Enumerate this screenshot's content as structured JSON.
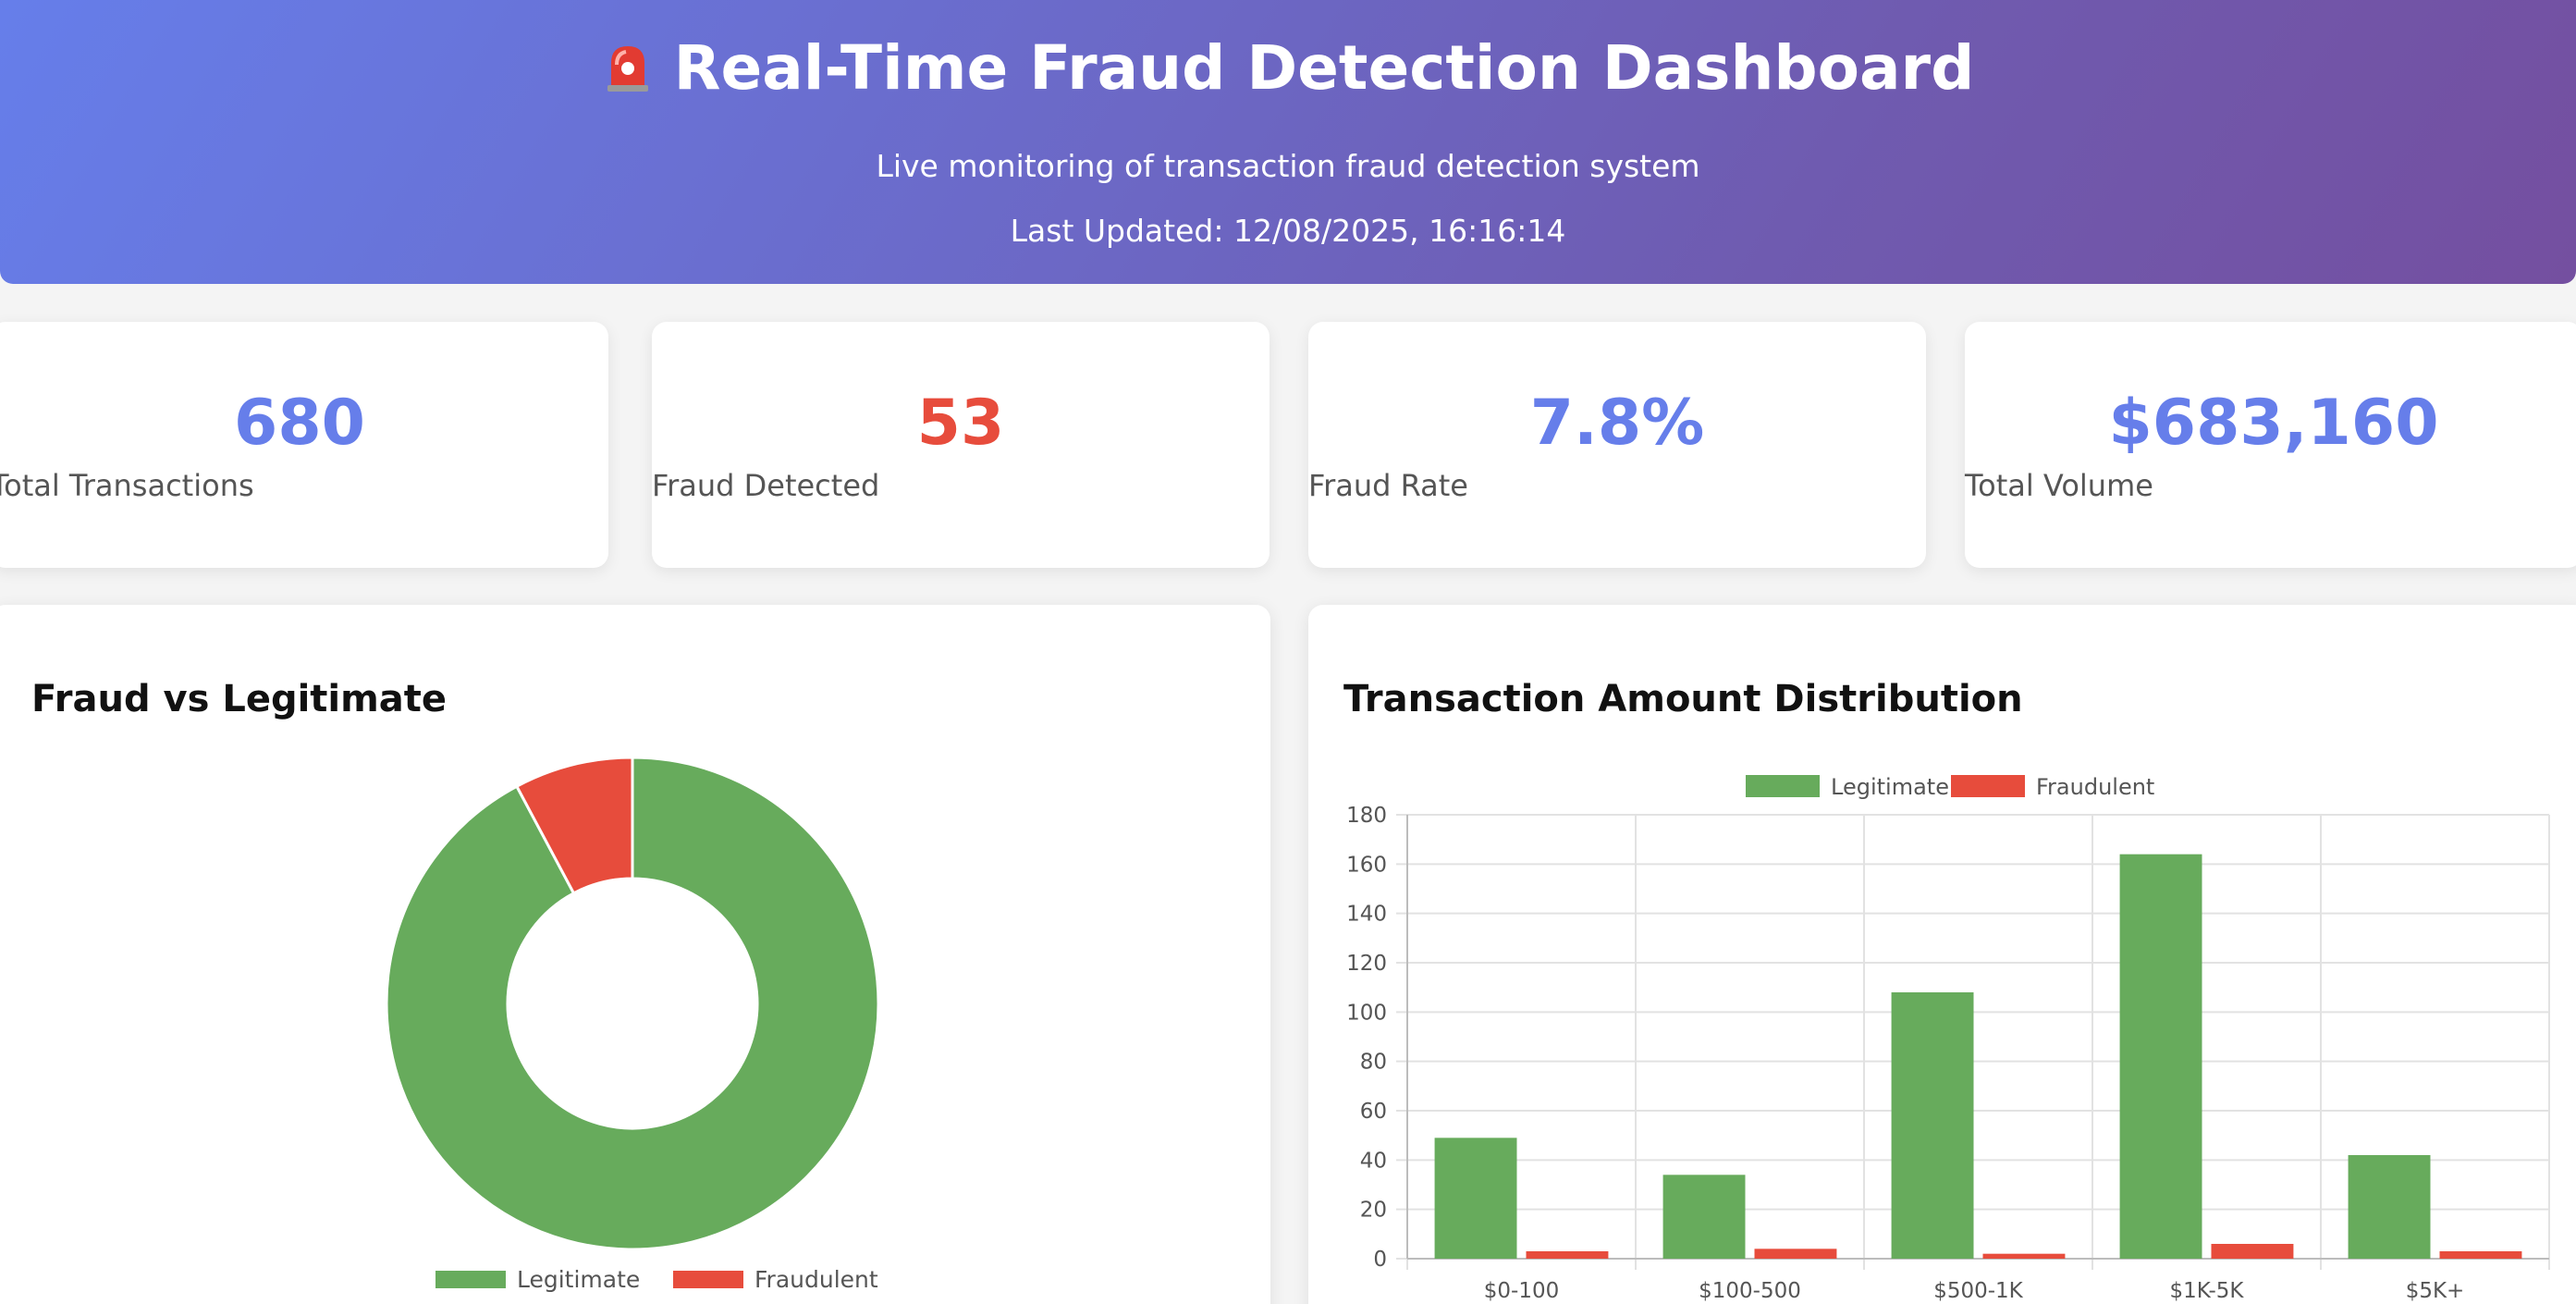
{
  "header": {
    "title": "Real-Time Fraud Detection Dashboard",
    "subtitle": "Live monitoring of transaction fraud detection system",
    "last_updated": "Last Updated: 12/08/2025, 16:16:14",
    "icon": "police-light-icon"
  },
  "stats": [
    {
      "value": "680",
      "label": "Total Transactions",
      "color": "#667eea"
    },
    {
      "value": "53",
      "label": "Fraud Detected",
      "color": "#e74c3c"
    },
    {
      "value": "7.8%",
      "label": "Fraud Rate",
      "color": "#667eea"
    },
    {
      "value": "$683,160",
      "label": "Total Volume",
      "color": "#667eea"
    }
  ],
  "panels": {
    "left_title": "Fraud vs Legitimate",
    "right_title": "Transaction Amount Distribution"
  },
  "colors": {
    "legitimate": "#67ab5c",
    "fraudulent": "#e74c3c",
    "accent": "#667eea"
  },
  "chart_data": [
    {
      "type": "pie",
      "title": "Fraud vs Legitimate",
      "categories": [
        "Legitimate",
        "Fraudulent"
      ],
      "values": [
        627,
        53
      ],
      "legend": "bottom"
    },
    {
      "type": "bar",
      "title": "Transaction Amount Distribution",
      "categories": [
        "$0-100",
        "$100-500",
        "$500-1K",
        "$1K-5K",
        "$5K+"
      ],
      "series": [
        {
          "name": "Legitimate",
          "values": [
            49,
            34,
            108,
            164,
            42
          ]
        },
        {
          "name": "Fraudulent",
          "values": [
            3,
            4,
            2,
            6,
            3
          ]
        }
      ],
      "ylim": [
        0,
        180
      ],
      "yticks": [
        "0",
        "20",
        "40",
        "60",
        "80",
        "100",
        "120",
        "140",
        "160",
        "180"
      ],
      "grid": true,
      "legend": "top"
    }
  ]
}
